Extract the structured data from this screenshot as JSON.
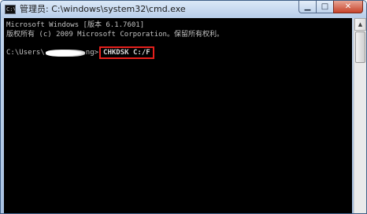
{
  "window": {
    "title": "管理员: C:\\windows\\system32\\cmd.exe",
    "app_icon": "cmd-icon",
    "controls": {
      "minimize": "▁",
      "maximize": "□",
      "close": "✕"
    }
  },
  "console": {
    "lines": [
      "Microsoft Windows [版本 6.1.7601]",
      "版权所有 (c) 2009 Microsoft Corporation。保留所有权利。"
    ],
    "prompt_prefix": "C:\\Users\\",
    "prompt_suffix": "ng>",
    "command": "CHKDSK C:/F",
    "highlight_color": "#e5201c"
  },
  "scrollbar": {
    "up_arrow": "▲"
  }
}
